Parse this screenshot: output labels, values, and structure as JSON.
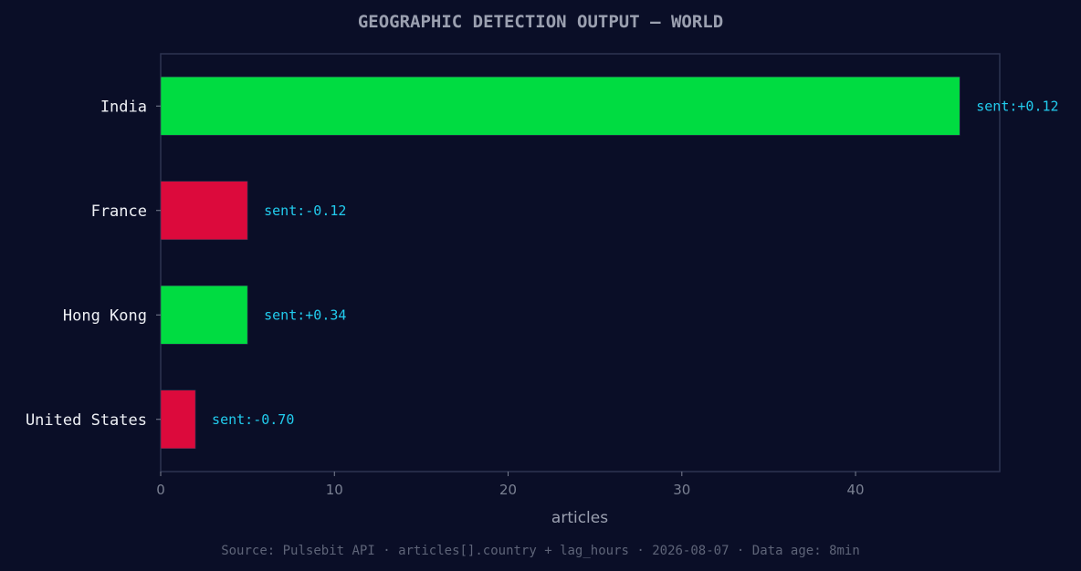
{
  "chart_data": {
    "type": "bar",
    "orientation": "horizontal",
    "title": "GEOGRAPHIC DETECTION OUTPUT — WORLD",
    "xlabel": "articles",
    "ylabel": "",
    "xlim": [
      0,
      48.3
    ],
    "xticks": [
      0,
      10,
      20,
      30,
      40
    ],
    "grid": false,
    "categories": [
      "India",
      "France",
      "Hong Kong",
      "United States"
    ],
    "values": [
      46,
      5,
      5,
      2
    ],
    "sentiment_labels": [
      "sent:+0.12",
      "sent:-0.12",
      "sent:+0.34",
      "sent:-0.70"
    ],
    "bar_colors": [
      "#00dc41",
      "#dc0a3c",
      "#00dc41",
      "#dc0a3c"
    ],
    "footer": "Source: Pulsebit API · articles[].country + lag_hours · 2026-08-07 · Data age: 8min"
  },
  "colors": {
    "background": "#0a0e27",
    "positive": "#00dc41",
    "negative": "#dc0a3c",
    "label_accent": "#22ccee",
    "title": "#9ba0b0",
    "tick_text": "#7a8092",
    "category_text": "#eef0f5",
    "frame": "#2d3350",
    "footer": "#5e6478"
  }
}
